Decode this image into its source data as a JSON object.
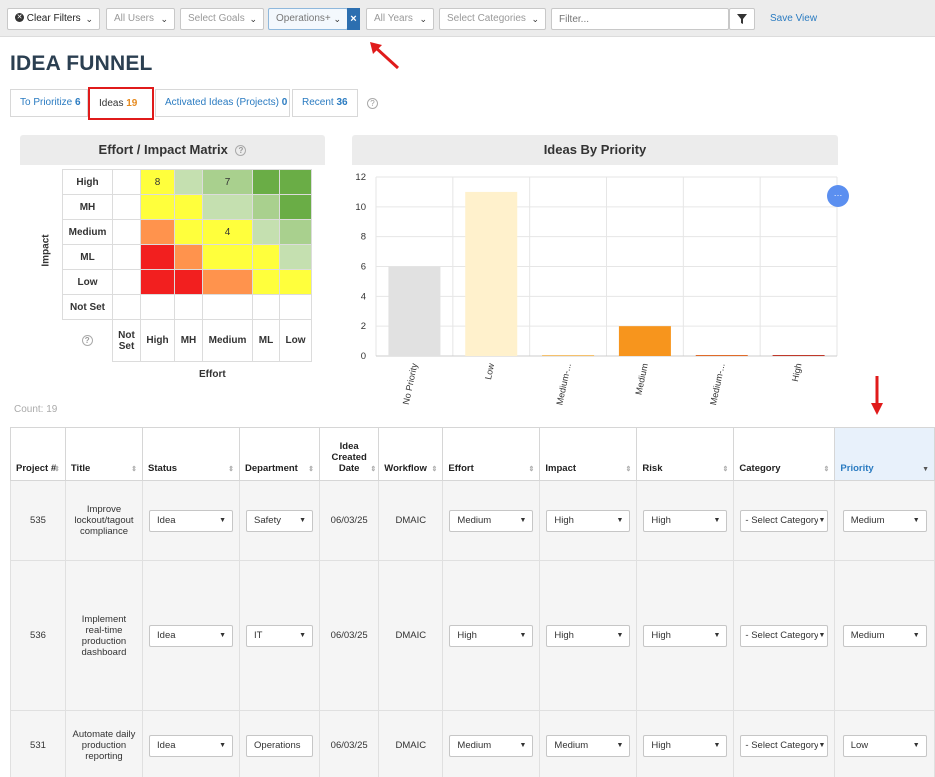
{
  "filters": {
    "clear_filters": "Clear Filters",
    "users": "All Users",
    "goals": "Select Goals",
    "department": "Operations+",
    "years": "All Years",
    "categories": "Select Categories",
    "search_placeholder": "Filter...",
    "save_view": "Save View"
  },
  "page_title": "IDEA FUNNEL",
  "tabs": [
    {
      "label": "To Prioritize",
      "count": "6"
    },
    {
      "label": "Ideas",
      "count": "19"
    },
    {
      "label": "Activated Ideas (Projects)",
      "count": "0"
    },
    {
      "label": "Recent",
      "count": "36"
    }
  ],
  "matrix": {
    "title": "Effort / Impact Matrix",
    "impact_label": "Impact",
    "effort_label": "Effort",
    "rows": [
      "High",
      "MH",
      "Medium",
      "ML",
      "Low",
      "Not Set"
    ],
    "cols": [
      "Not Set",
      "High",
      "MH",
      "Medium",
      "ML",
      "Low"
    ],
    "counts": {
      "High-High": "8",
      "High-Medium": "7",
      "Medium-Medium": "4"
    }
  },
  "chart_data": {
    "type": "bar",
    "title": "Ideas By Priority",
    "categories": [
      "No Priority",
      "Low",
      "Medium-...",
      "Medium",
      "Medium-...",
      "High"
    ],
    "values": [
      6,
      11,
      0,
      2,
      0,
      0
    ],
    "colors": [
      "#e1e1e1",
      "#fff1cc",
      "#f5c16c",
      "#f7951d",
      "#e06b2a",
      "#c0392b"
    ],
    "ylim": [
      0,
      12
    ],
    "yticks": [
      0,
      2,
      4,
      6,
      8,
      10,
      12
    ],
    "grid": true
  },
  "count_label": "Count: 19",
  "table": {
    "headers": {
      "project": "Project #",
      "title": "Title",
      "status": "Status",
      "department": "Department",
      "created": "Idea Created Date",
      "workflow": "Workflow",
      "effort": "Effort",
      "impact": "Impact",
      "risk": "Risk",
      "category": "Category",
      "priority": "Priority"
    },
    "rows": [
      {
        "project": "535",
        "title": "Improve lockout/tagout compliance",
        "status": "Idea",
        "department": "Safety",
        "created": "06/03/25",
        "workflow": "DMAIC",
        "effort": "Medium",
        "impact": "High",
        "risk": "High",
        "category": "- Select Category -",
        "priority": "Medium"
      },
      {
        "project": "536",
        "title": "Implement real-time production dashboard",
        "status": "Idea",
        "department": "IT",
        "created": "06/03/25",
        "workflow": "DMAIC",
        "effort": "High",
        "impact": "High",
        "risk": "High",
        "category": "- Select Category -",
        "priority": "Medium"
      },
      {
        "project": "531",
        "title": "Automate daily production reporting",
        "status": "Idea",
        "department": "Operations",
        "created": "06/03/25",
        "workflow": "DMAIC",
        "effort": "Medium",
        "impact": "Medium",
        "risk": "High",
        "category": "- Select Category -",
        "priority": "Low"
      }
    ]
  },
  "colors": {
    "accent": "#2a7bc1",
    "callout": "#e01b1b",
    "count_orange": "#e68a1f"
  }
}
